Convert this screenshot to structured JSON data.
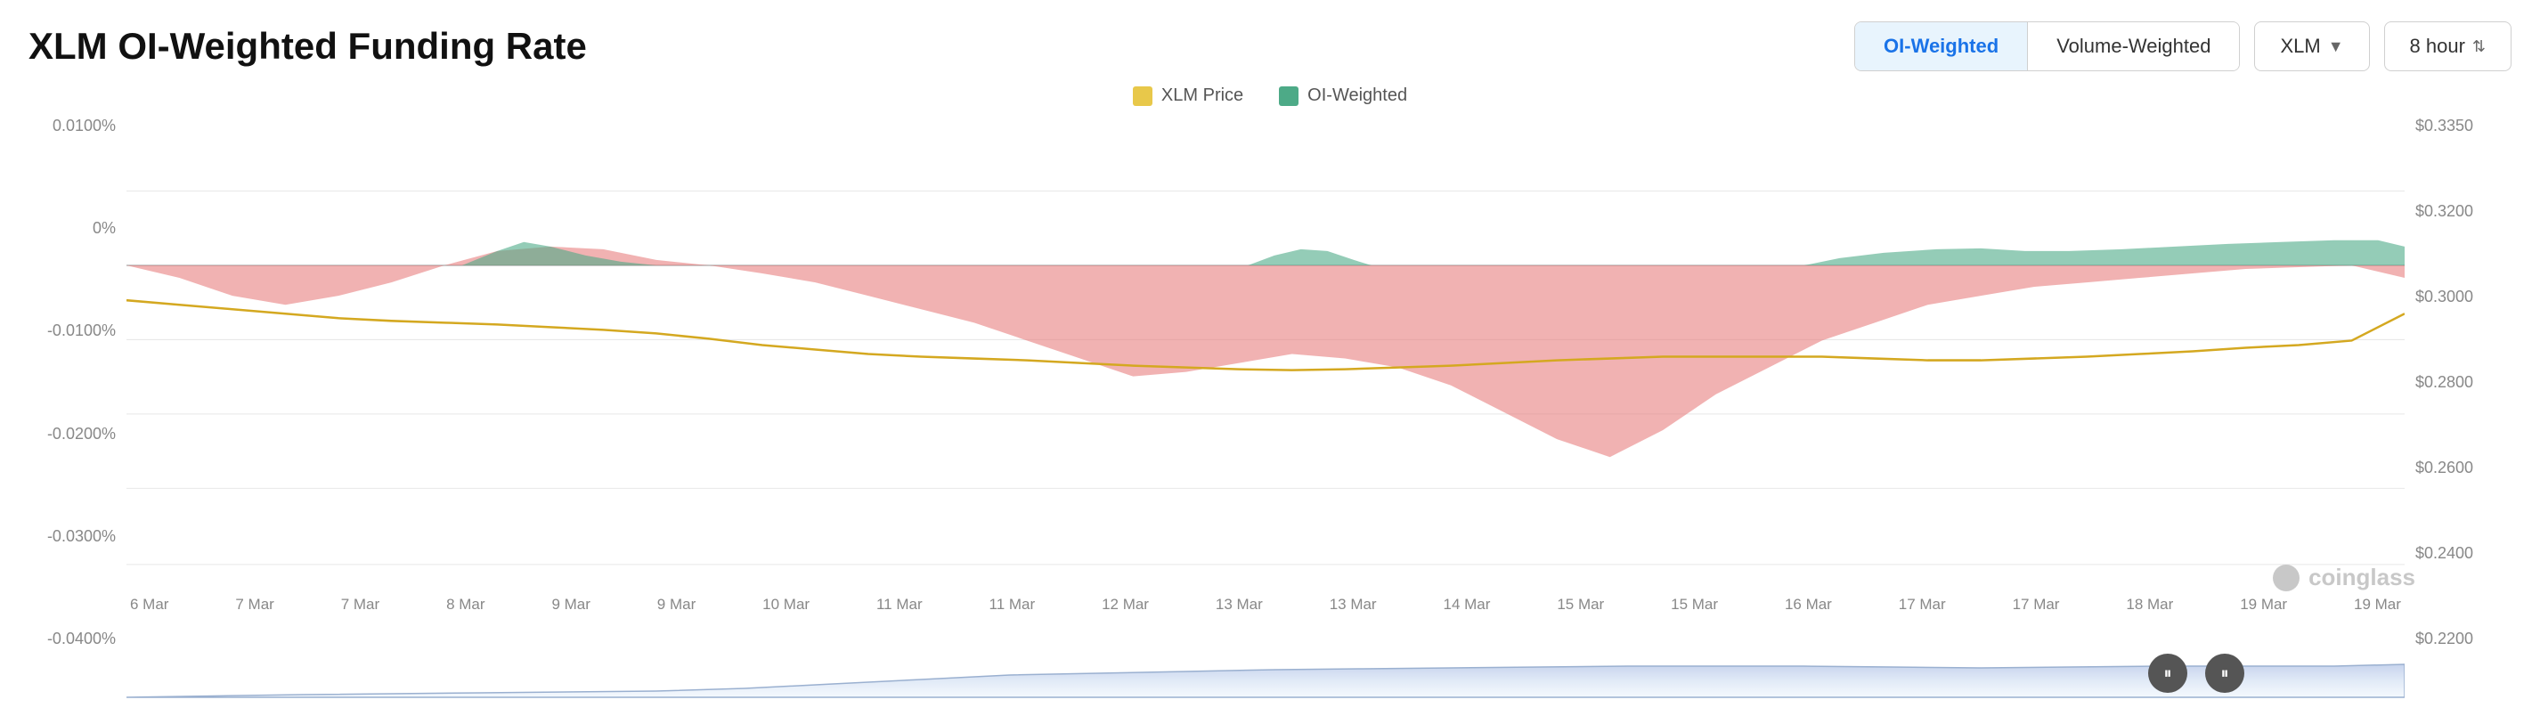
{
  "title": "XLM OI-Weighted Funding Rate",
  "controls": {
    "oi_weighted_label": "OI-Weighted",
    "volume_weighted_label": "Volume-Weighted",
    "asset_label": "XLM",
    "interval_label": "8 hour"
  },
  "legend": {
    "items": [
      {
        "label": "XLM Price",
        "color": "#e8c84a"
      },
      {
        "label": "OI-Weighted",
        "color": "#4daa87"
      }
    ]
  },
  "y_axis_left": {
    "labels": [
      "0.0100%",
      "0%",
      "-0.0100%",
      "-0.0200%",
      "-0.0300%",
      "-0.0400%"
    ]
  },
  "y_axis_right": {
    "labels": [
      "$0.3350",
      "$0.3200",
      "$0.3000",
      "$0.2800",
      "$0.2600",
      "$0.2400",
      "$0.2200"
    ]
  },
  "x_axis": {
    "labels": [
      "6 Mar",
      "7 Mar",
      "7 Mar",
      "8 Mar",
      "9 Mar",
      "9 Mar",
      "10 Mar",
      "11 Mar",
      "11 Mar",
      "12 Mar",
      "13 Mar",
      "13 Mar",
      "14 Mar",
      "15 Mar",
      "15 Mar",
      "16 Mar",
      "17 Mar",
      "17 Mar",
      "18 Mar",
      "19 Mar",
      "19 Mar"
    ]
  },
  "watermark": "coinglass",
  "pause_buttons": [
    "pause-left",
    "pause-right"
  ]
}
